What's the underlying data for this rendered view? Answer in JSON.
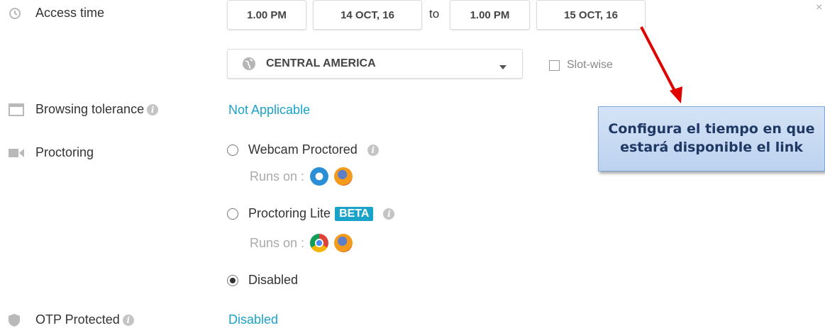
{
  "access_time": {
    "label": "Access time",
    "start_time": "1.00 PM",
    "start_date": "14 OCT, 16",
    "to": "to",
    "end_time": "1.00 PM",
    "end_date": "15 OCT, 16"
  },
  "timezone": {
    "value": "CENTRAL AMERICA",
    "slot_wise_label": "Slot-wise",
    "slot_wise_checked": false
  },
  "browsing_tolerance": {
    "label": "Browsing tolerance",
    "value": "Not Applicable"
  },
  "proctoring": {
    "label": "Proctoring",
    "options": [
      {
        "label": "Webcam Proctored",
        "runs_on": "Runs on :",
        "selected": false
      },
      {
        "label": "Proctoring Lite",
        "badge": "BETA",
        "runs_on": "Runs on :",
        "selected": false
      },
      {
        "label": "Disabled",
        "selected": true
      }
    ]
  },
  "otp": {
    "label": "OTP Protected",
    "value": "Disabled"
  },
  "callout": {
    "text": "Configura el tiempo en que estará disponible el link"
  },
  "colors": {
    "link": "#1aa3c8",
    "beta": "#1aa3c8",
    "arrow": "#e00000",
    "callout_bg": "#c9dcf3"
  }
}
